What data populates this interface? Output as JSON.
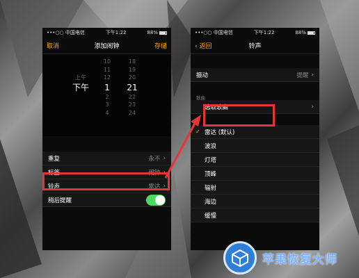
{
  "colors": {
    "accent": "#f5a524",
    "highlight": "#e53636",
    "toggle_on": "#4cd964",
    "watermark": "#2f7fd8"
  },
  "left": {
    "status": {
      "carrier": "•••○○ 中国电信",
      "wifi": "wifi-icon",
      "time": "下午1:22",
      "battery": "88%"
    },
    "nav": {
      "cancel": "取消",
      "title": "添加闹钟",
      "save": "存储"
    },
    "picker": {
      "ampm": [
        "上午",
        "下午"
      ],
      "hours": [
        "10",
        "11",
        "12",
        "1",
        "2",
        "3",
        "4"
      ],
      "minutes": [
        "18",
        "19",
        "20",
        "21",
        "22",
        "23",
        "24"
      ]
    },
    "rows": [
      {
        "label": "重复",
        "value": "永不"
      },
      {
        "label": "标签",
        "value": "闹钟"
      },
      {
        "label": "铃声",
        "value": "雷达"
      },
      {
        "label": "稍后提醒",
        "toggle": true
      }
    ]
  },
  "right": {
    "status": {
      "carrier": "•••○○ 中国电信",
      "wifi": "wifi-icon",
      "time": "下午1:22",
      "battery": "88%"
    },
    "nav": {
      "back": "返回",
      "title": "铃声"
    },
    "vibration": {
      "label": "振动",
      "value": "提醒"
    },
    "song_section": "歌曲",
    "pick_song": "选取歌曲",
    "tones": [
      "雷达 (默认)",
      "波浪",
      "灯塔",
      "顶峰",
      "辐射",
      "海边",
      "缓慢"
    ]
  },
  "watermark": {
    "text": "苹果恢复大师",
    "icon": "cube-icon"
  }
}
